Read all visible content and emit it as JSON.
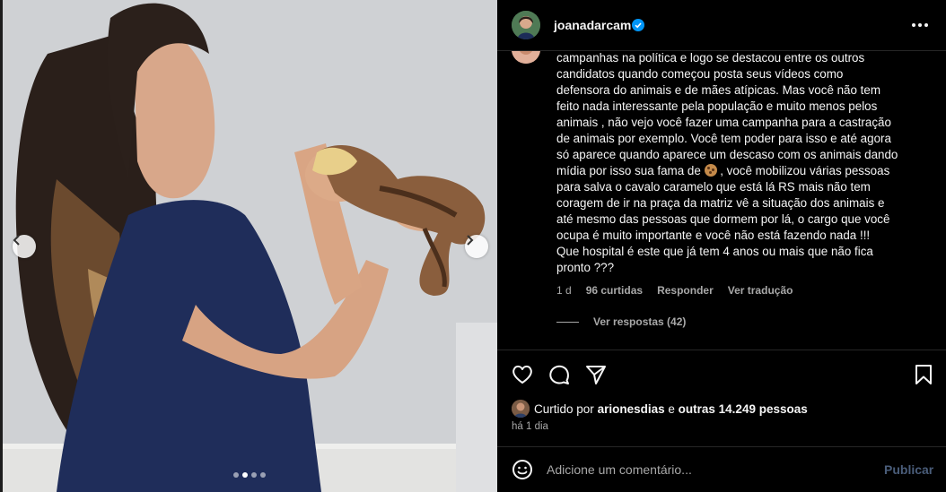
{
  "post": {
    "username": "joanadarcam",
    "verified": true,
    "carousel": {
      "total_slides": 4,
      "active_slide": 2
    }
  },
  "comment": {
    "text_before": "campanhas na política e logo se destacou entre os outros\ncandidatos quando começou posta seus vídeos como\ndefensora do animais e de mães atípicas. Mas você não tem\nfeito nada interessante pela população e muito menos pelos\nanimais , não vejo você fazer uma campanha para a castração\nde animais por exemplo. Você tem poder para isso e até agora\nsó aparece quando aparece um descaso com os animais dando\nmídia por isso sua fama de ",
    "emoji": "cookie",
    "text_after": " , você mobilizou várias pessoas\npara salva o cavalo caramelo que está lá RS mais não tem\ncoragem de ir na praça da matriz vê a situação dos animais e\naté mesmo das pessoas que dormem por lá, o cargo que você\nocupa é muito importante e você não está fazendo nada !!!\nQue hospital é este que já tem 4 anos ou mais que não fica\npronto ???",
    "age": "1 d",
    "likes": "96 curtidas",
    "reply_label": "Responder",
    "translate_label": "Ver tradução",
    "view_replies": "Ver respostas (42)"
  },
  "actions": {
    "like_icon": "heart-icon",
    "comment_icon": "comment-icon",
    "share_icon": "send-icon",
    "save_icon": "bookmark-icon"
  },
  "likes": {
    "prefix": "Curtido por",
    "user": "arionesdias",
    "conjunction": "e",
    "others": "outras 14.249 pessoas"
  },
  "time": "há 1 dia",
  "comment_box": {
    "placeholder": "Adicione um comentário...",
    "publish_label": "Publicar"
  },
  "colors": {
    "background": "#000000",
    "text": "#f5f5f5",
    "muted": "#a8a8a8",
    "verified": "#0095f6",
    "publish_disabled": "#4a5d7a"
  }
}
